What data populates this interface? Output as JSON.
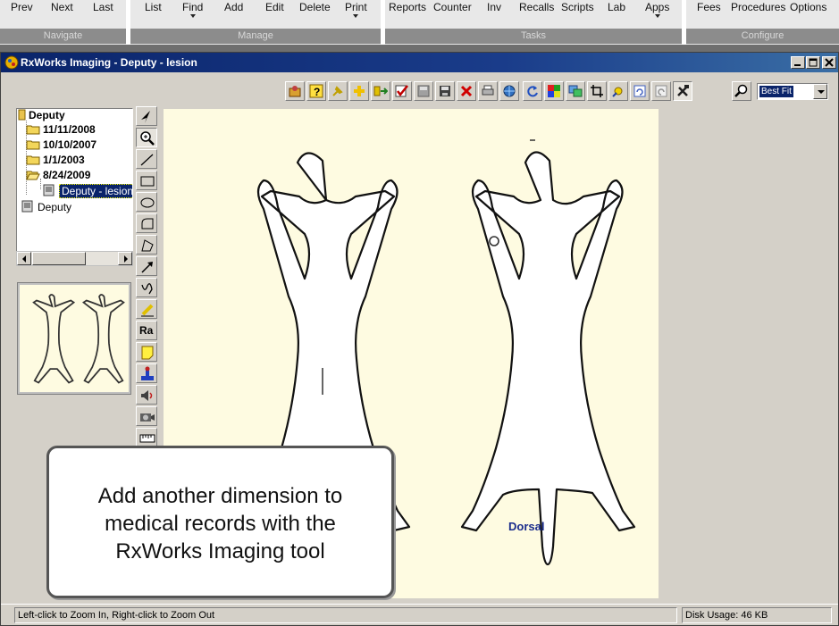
{
  "ribbon": {
    "navigate": {
      "caption": "Navigate",
      "buttons": [
        "Prev",
        "Next",
        "Last"
      ]
    },
    "manage": {
      "caption": "Manage",
      "buttons": [
        "List",
        "Find",
        "Add",
        "Edit",
        "Delete",
        "Print"
      ]
    },
    "tasks": {
      "caption": "Tasks",
      "buttons": [
        "Reports",
        "Counter",
        "Inv",
        "Recalls",
        "Scripts",
        "Lab",
        "Apps"
      ]
    },
    "configure": {
      "caption": "Configure",
      "buttons": [
        "Fees",
        "Procedures",
        "Options"
      ]
    }
  },
  "window": {
    "title": "RxWorks Imaging - Deputy - lesion"
  },
  "toolbar": {
    "zoom_value": "Best Fit"
  },
  "tree": {
    "root": "Deputy",
    "dates": [
      "11/11/2008",
      "10/10/2007",
      "1/1/2003",
      "8/24/2009"
    ],
    "selected_image": "Deputy - lesion",
    "patient_node": "Deputy"
  },
  "canvas": {
    "view_label": "Dorsal"
  },
  "callout": {
    "line1": "Add another dimension to",
    "line2": "medical records with the",
    "line3": "RxWorks Imaging tool"
  },
  "status": {
    "hint": "Left-click to Zoom In, Right-click to Zoom Out",
    "disk_usage": "Disk Usage: 46 KB"
  },
  "colors": {
    "title_bar": "#0a246a",
    "canvas_bg": "#fefbe1",
    "dorsal_label": "#1a2c8c"
  }
}
